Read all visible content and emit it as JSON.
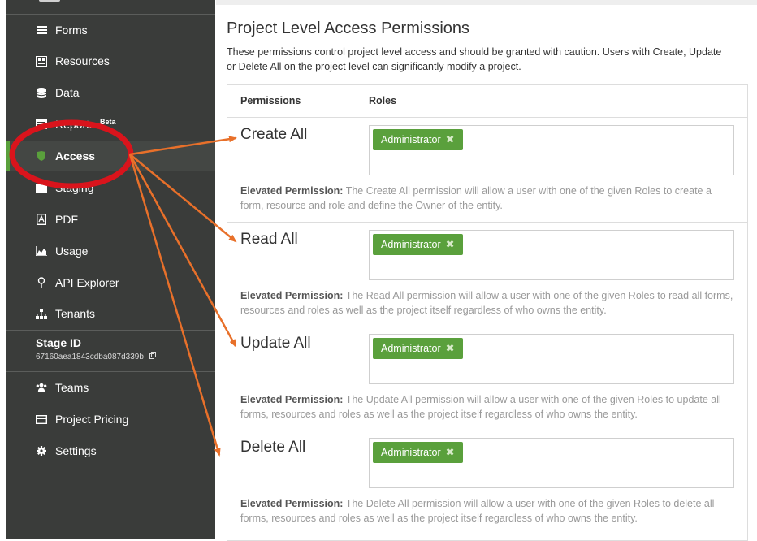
{
  "sidebar": {
    "items": [
      {
        "label": "Forms",
        "icon": "forms-icon"
      },
      {
        "label": "Resources",
        "icon": "resources-icon"
      },
      {
        "label": "Data",
        "icon": "database-icon"
      },
      {
        "label": "Reports",
        "badge": "Beta",
        "icon": "reports-icon"
      },
      {
        "label": "Access",
        "icon": "shield-icon"
      },
      {
        "label": "Staging",
        "icon": "folder-icon"
      },
      {
        "label": "PDF",
        "icon": "pdf-icon"
      },
      {
        "label": "Usage",
        "icon": "area-chart-icon"
      },
      {
        "label": "API Explorer",
        "icon": "map-pin-icon"
      },
      {
        "label": "Tenants",
        "icon": "sitemap-icon"
      },
      {
        "label": "Teams",
        "icon": "users-icon"
      },
      {
        "label": "Project Pricing",
        "icon": "credit-card-icon"
      },
      {
        "label": "Settings",
        "icon": "gear-icon"
      }
    ],
    "stage": {
      "title": "Stage ID",
      "value": "67160aea1843cdba087d339b"
    }
  },
  "main": {
    "title": "Project Level Access Permissions",
    "description": "These permissions control project level access and should be granted with caution. Users with Create, Update or Delete All on the project level can significantly modify a project.",
    "columns": {
      "permissions": "Permissions",
      "roles": "Roles"
    },
    "rows": [
      {
        "name": "Create All",
        "role": "Administrator",
        "desc_label": "Elevated Permission:",
        "desc": " The Create All permission will allow a user with one of the given Roles to create a form, resource and role and define the Owner of the entity."
      },
      {
        "name": "Read All",
        "role": "Administrator",
        "desc_label": "Elevated Permission:",
        "desc": " The Read All permission will allow a user with one of the given Roles to read all forms, resources and roles as well as the project itself regardless of who owns the entity."
      },
      {
        "name": "Update All",
        "role": "Administrator",
        "desc_label": "Elevated Permission:",
        "desc": " The Update All permission will allow a user with one of the given Roles to update all forms, resources and roles as well as the project itself regardless of who owns the entity."
      },
      {
        "name": "Delete All",
        "role": "Administrator",
        "desc_label": "Elevated Permission:",
        "desc": " The Delete All permission will allow a user with one of the given Roles to delete all forms, resources and roles as well as the project itself regardless of who owns the entity."
      }
    ]
  },
  "colors": {
    "sidebar_bg": "#3a3c3a",
    "accent_green": "#5aa03c",
    "annotation_red": "#d9141c",
    "annotation_orange": "#e8702a"
  }
}
